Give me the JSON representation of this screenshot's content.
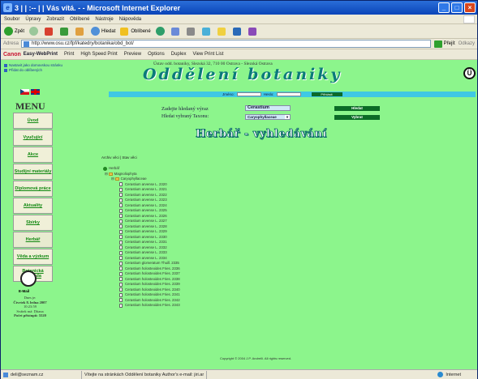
{
  "window": {
    "title": "3 | | :-- | | Vás vítá. - - Microsoft Internet Explorer",
    "controls": {
      "minimize": "_",
      "maximize": "□",
      "close": "×"
    }
  },
  "menubar": [
    "Soubor",
    "Úpravy",
    "Zobrazit",
    "Oblíbené",
    "Nástroje",
    "Nápověda"
  ],
  "toolbar": {
    "back": "Zpět",
    "search": "Hledat",
    "favorites": "Oblíbené"
  },
  "address": {
    "label": "Adresa",
    "url": "http://www.osu.cz/fpf/katedry/botanika/obd_bot/",
    "go": "Přejít",
    "links": "Odkazy"
  },
  "canonbar": {
    "brand": "Canon",
    "product": "Easy-WebPrint",
    "print": "Print",
    "hs_print": "High Speed Print",
    "preview": "Preview",
    "options": "Options",
    "duplex": "Duplex",
    "view_list": "View Print List"
  },
  "page": {
    "top_links": [
      "Nastavit jako domovskou stránku",
      "Přidat do oblíbených"
    ],
    "school_line": "Ústav odd. botaniky, Slezská 32, 710 00 Ostrava - Slezská Ostrava",
    "banner": "Oddělení botaniky",
    "stripe": {
      "label1": "Jméno:",
      "label2": "Heslo:",
      "button": "Přihlásit"
    },
    "menu_title": "MENU",
    "menu": [
      "Úvod",
      "Vyučující",
      "Akce",
      "Studijní materiály",
      "Diplomová práce",
      "Aktuality",
      "Sbírky",
      "Herbář",
      "Věda a výzkum",
      "Botanická zahrada"
    ],
    "side_logo_text": "E-Mail",
    "date": {
      "line1": "Dnes je:",
      "line2": "Čtvrtek 8. ledna 2007",
      "line3": "10:23:59",
      "line4": "Svátek má: Dítana",
      "line5": "Počet přístupů: 5520"
    },
    "search": {
      "q_label": "Zadejte hledaný výraz",
      "q_value": "Cerastium",
      "q_button": "Hledat",
      "tax_label": "Hledat vybraný Taxonu:",
      "tax_value": "Caryophyllaceae",
      "tax_button": "Vybrat"
    },
    "heading": "Herbář - vyhledávání",
    "breadcrumb": "Archiv věci | Stav věci",
    "tree_root": "Herbář",
    "tree_l1": "Magnoliophyta",
    "tree_l2": "Caryophyllaceae",
    "entries": [
      "Cerastium arvense L. 2320",
      "Cerastium arvense L. 2321",
      "Cerastium arvense L. 2322",
      "Cerastium arvense L. 2323",
      "Cerastium arvense L. 2324",
      "Cerastium arvense L. 2325",
      "Cerastium arvense L. 2326",
      "Cerastium arvense L. 2327",
      "Cerastium arvense L. 2328",
      "Cerastium arvense L. 2329",
      "Cerastium arvense L. 2330",
      "Cerastium arvense L. 2331",
      "Cerastium arvense L. 2332",
      "Cerastium arvense L. 2333",
      "Cerastium arvense L. 2334",
      "Cerastium glomeratum Thuill. 2335",
      "Cerastium holosteoides Fries. 2336",
      "Cerastium holosteoides Fries. 2337",
      "Cerastium holosteoides Fries. 2338",
      "Cerastium holosteoides Fries. 2339",
      "Cerastium holosteoides Fries. 2340",
      "Cerastium holosteoides Fries. 2341",
      "Cerastium holosteoides Fries. 2342",
      "Cerastium holosteoides Fries. 2343"
    ],
    "footer": "Copyright © 2004 J.P. Andrelli. All rights reserved."
  },
  "status": {
    "mail": "deli@seznam.cz",
    "message": "Vítejte na stránkách Oddělení botaniky   Author's e-mail: jiri.ar",
    "zone": "Internet"
  },
  "colors": {
    "page_bg": "#8cf58c",
    "stripe": "#3fc8e4",
    "banner": "#0a7a7a",
    "menu_link": "#118811"
  }
}
